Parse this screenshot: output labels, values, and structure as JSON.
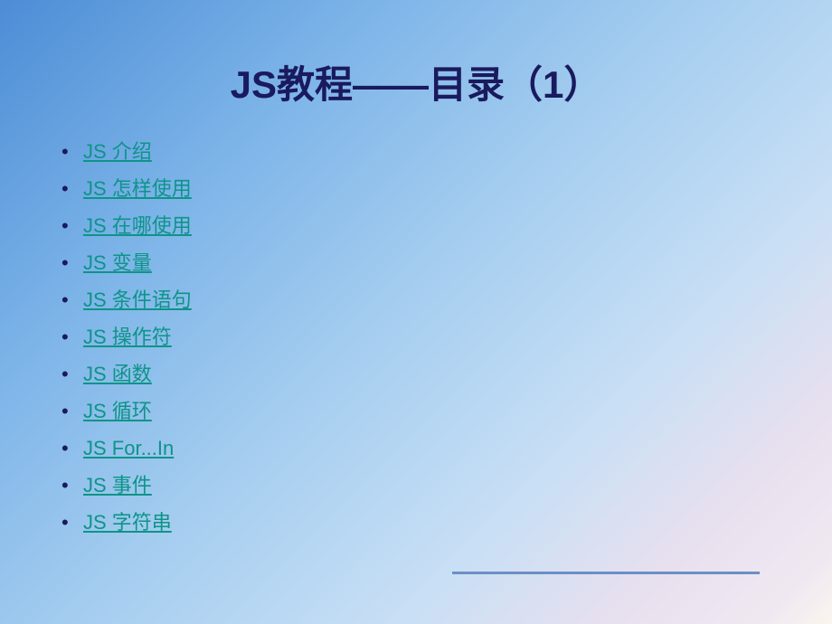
{
  "title": "JS教程——目录（1）",
  "toc": {
    "items": [
      {
        "label": "JS 介绍"
      },
      {
        "label": "JS 怎样使用"
      },
      {
        "label": "JS 在哪使用"
      },
      {
        "label": "JS 变量"
      },
      {
        "label": "JS 条件语句"
      },
      {
        "label": "JS 操作符"
      },
      {
        "label": "JS 函数"
      },
      {
        "label": "JS 循环"
      },
      {
        "label": "JS For...In"
      },
      {
        "label": "JS 事件"
      },
      {
        "label": "JS 字符串"
      }
    ]
  }
}
